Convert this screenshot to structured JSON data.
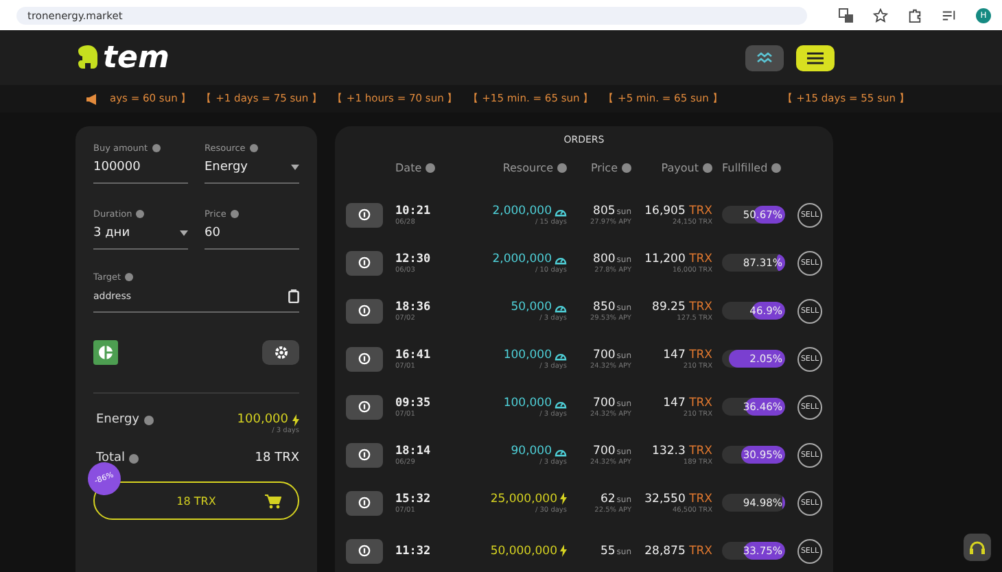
{
  "browser": {
    "url": "tronenergy.market",
    "avatar": "H"
  },
  "header": {
    "logo": "tem"
  },
  "ticker": [
    "ays = 60 sun 】",
    "【 +1 days = 75 sun 】",
    "【 +1 hours = 70 sun 】",
    "【 +15 min. = 65 sun 】",
    "【 +5 min. = 65 sun 】",
    "【 +15 days = 55 sun 】"
  ],
  "form": {
    "fields": [
      {
        "label": "Buy amount",
        "value": "100000",
        "kind": "input"
      },
      {
        "label": "Resource",
        "value": "Energy",
        "kind": "select"
      },
      {
        "label": "Duration",
        "value": "3 дни",
        "kind": "select"
      },
      {
        "label": "Price",
        "value": "60",
        "kind": "input"
      }
    ],
    "target": {
      "label": "Target",
      "placeholder": "address"
    },
    "summary": {
      "label": "Energy",
      "amount": "100,000",
      "duration": "/ 3 days"
    },
    "total": {
      "label": "Total",
      "value": "18 TRX"
    },
    "buy_button": "18 TRX",
    "discount_badge": "-86%"
  },
  "orders": {
    "title": "ORDERS",
    "columns": [
      "Date",
      "Resource",
      "Price",
      "Payout",
      "Fullfilled"
    ],
    "rows": [
      {
        "time": "10:21",
        "date": "06/28",
        "amount": "2,000,000",
        "kind": "bandwidth",
        "duration": "/ 15 days",
        "price": "805",
        "unit": "sun",
        "apy": "27.97% APY",
        "payout": "16,905",
        "currency": "TRX",
        "payout_total": "24,150 TRX",
        "fulfilled": "50.67%",
        "level": 0.49,
        "action": "SELL"
      },
      {
        "time": "12:30",
        "date": "06/03",
        "amount": "2,000,000",
        "kind": "bandwidth",
        "duration": "/ 10 days",
        "price": "800",
        "unit": "sun",
        "apy": "27.8% APY",
        "payout": "11,200",
        "currency": "TRX",
        "payout_total": "16,000 TRX",
        "fulfilled": "87.31%",
        "level": 0.13,
        "action": "SELL"
      },
      {
        "time": "18:36",
        "date": "07/02",
        "amount": "50,000",
        "kind": "bandwidth",
        "duration": "/ 3 days",
        "price": "850",
        "unit": "sun",
        "apy": "29.53% APY",
        "payout": "89.25",
        "currency": "TRX",
        "payout_total": "127.5 TRX",
        "fulfilled": "46.9%",
        "level": 0.53,
        "action": "SELL"
      },
      {
        "time": "16:41",
        "date": "07/01",
        "amount": "100,000",
        "kind": "bandwidth",
        "duration": "/ 3 days",
        "price": "700",
        "unit": "sun",
        "apy": "24.32% APY",
        "payout": "147",
        "currency": "TRX",
        "payout_total": "210 TRX",
        "fulfilled": "2.05%",
        "level": 0.9,
        "action": "SELL"
      },
      {
        "time": "09:35",
        "date": "07/01",
        "amount": "100,000",
        "kind": "bandwidth",
        "duration": "/ 3 days",
        "price": "700",
        "unit": "sun",
        "apy": "24.32% APY",
        "payout": "147",
        "currency": "TRX",
        "payout_total": "210 TRX",
        "fulfilled": "36.46%",
        "level": 0.64,
        "action": "SELL"
      },
      {
        "time": "18:14",
        "date": "06/29",
        "amount": "90,000",
        "kind": "bandwidth",
        "duration": "/ 3 days",
        "price": "700",
        "unit": "sun",
        "apy": "24.32% APY",
        "payout": "132.3",
        "currency": "TRX",
        "payout_total": "189 TRX",
        "fulfilled": "30.95%",
        "level": 0.69,
        "action": "SELL"
      },
      {
        "time": "15:32",
        "date": "07/01",
        "amount": "25,000,000",
        "kind": "energy",
        "duration": "/ 30 days",
        "price": "62",
        "unit": "sun",
        "apy": "22.5% APY",
        "payout": "32,550",
        "currency": "TRX",
        "payout_total": "46,500 TRX",
        "fulfilled": "94.98%",
        "level": 0.05,
        "action": "SELL"
      },
      {
        "time": "11:32",
        "amount": "50,000,000",
        "kind": "energy",
        "price": "55",
        "unit": "sun",
        "payout": "28,875",
        "currency": "TRX",
        "fulfilled": "33.75%",
        "level": 0.66,
        "action": "SELL"
      }
    ]
  }
}
